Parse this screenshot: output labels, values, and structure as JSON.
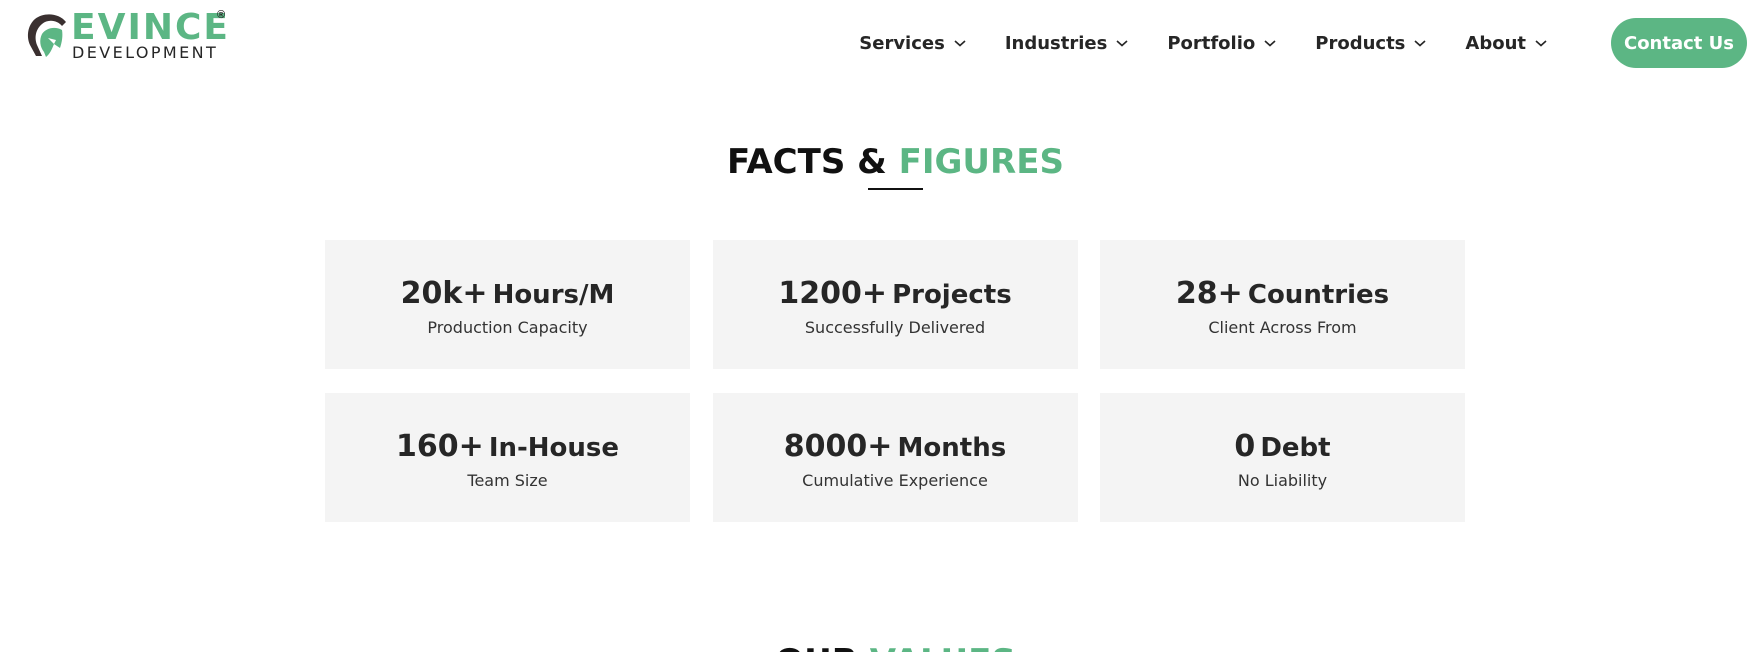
{
  "brand": {
    "name": "EVINCE",
    "subtitle": "DEVELOPMENT",
    "registered": "®",
    "accent_color": "#5cb684",
    "dark_color": "#3a3030"
  },
  "nav": {
    "items": [
      {
        "label": "Services",
        "icon": "chevron-down-icon"
      },
      {
        "label": "Industries",
        "icon": "chevron-down-icon"
      },
      {
        "label": "Portfolio",
        "icon": "chevron-down-icon"
      },
      {
        "label": "Products",
        "icon": "chevron-down-icon"
      },
      {
        "label": "About",
        "icon": "chevron-down-icon"
      }
    ],
    "cta_label": "Contact Us"
  },
  "facts": {
    "title_main": "FACTS & ",
    "title_accent": "FIGURES",
    "cards": [
      {
        "number": "20k+",
        "unit": "Hours/M",
        "caption": "Production Capacity"
      },
      {
        "number": "1200+",
        "unit": "Projects",
        "caption": "Successfully Delivered"
      },
      {
        "number": "28+",
        "unit": "Countries",
        "caption": "Client Across From"
      },
      {
        "number": "160+",
        "unit": "In-House",
        "caption": "Team Size"
      },
      {
        "number": "8000+",
        "unit": "Months",
        "caption": "Cumulative Experience"
      },
      {
        "number": "0",
        "unit": "Debt",
        "caption": "No Liability"
      }
    ]
  },
  "next_section": {
    "title_main": "OUR ",
    "title_accent": "VALUES"
  }
}
